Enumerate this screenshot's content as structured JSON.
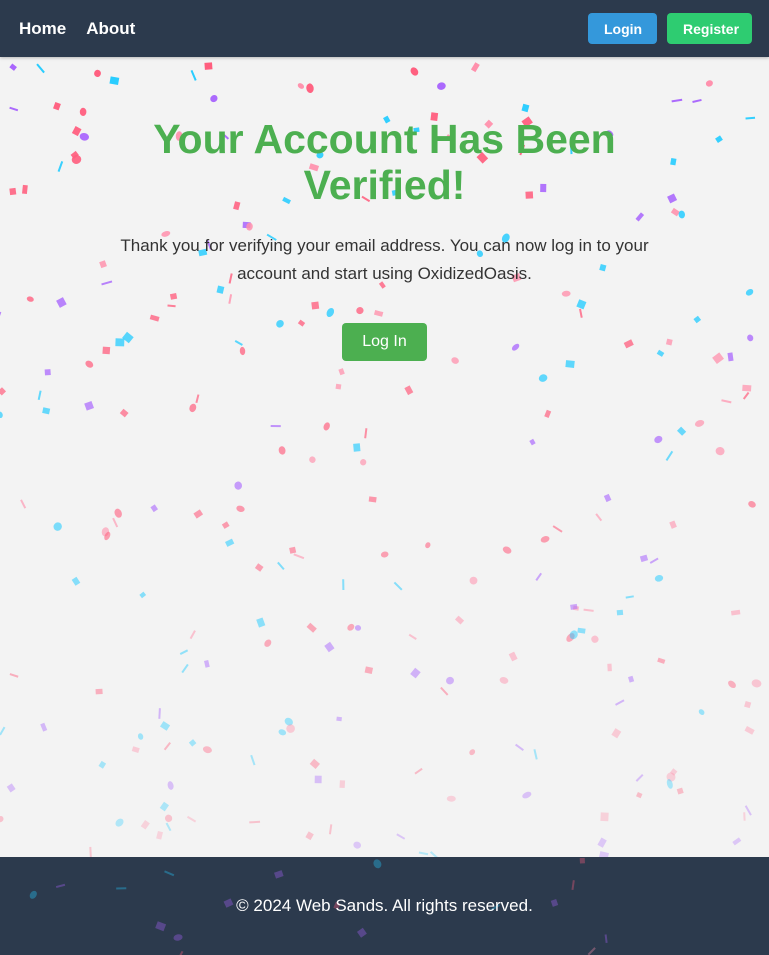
{
  "nav": {
    "home": "Home",
    "about": "About",
    "login": "Login",
    "register": "Register"
  },
  "main": {
    "title": "Your Account Has Been Verified!",
    "message": "Thank you for verifying your email address. You can now log in to your account and start using OxidizedOasis.",
    "cta": "Log In"
  },
  "footer": {
    "copyright": "© 2024 Web Sands. All rights reserved."
  },
  "colors": {
    "navbar_bg": "#2c3a4d",
    "login_btn": "#3498db",
    "register_btn": "#2ecc71",
    "accent_green": "#4caf50",
    "confetti": [
      "#ff5e7e",
      "#a864fd",
      "#26ccff",
      "#ff8fab"
    ]
  },
  "decoration": "confetti-overlay"
}
